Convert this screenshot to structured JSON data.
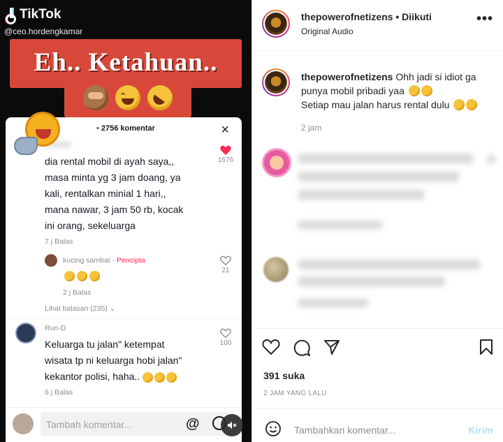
{
  "tiktok": {
    "brand": "TikTok",
    "username": "@ceo.hordengkamar",
    "banner_text": "Eh.. Ketahuan..",
    "comment_count_label": "2756 komentar",
    "close_symbol": "×",
    "comments": [
      {
        "text_lines": [
          "dia rental mobil di ayah saya,,",
          "masa minta yg 3 jam doang, ya",
          "kali, rentalkan minial 1 hari,,",
          "mana nawar, 3 jam 50 rb, kocak",
          "ini orang, sekeluarga"
        ],
        "meta": "7 j   Balas",
        "likes": "1676"
      },
      {
        "author": "kucing sambat",
        "badge": "· Pencipta",
        "meta": "2 j   Balas",
        "likes": "21"
      },
      {
        "author": "Run-D",
        "text_lines": [
          "Keluarga tu jalan\" ketempat",
          "wisata tp ni keluarga hobi jalan\"",
          "kekantor polisi, haha.."
        ],
        "meta": "6 j   Balas",
        "likes": "100"
      }
    ],
    "view_replies": "Lihat balasan (235)",
    "input_placeholder": "Tambah komentar...",
    "at_symbol": "@"
  },
  "instagram": {
    "username": "thepowerofnetizens",
    "follow_status": " • Diikuti",
    "audio": "Original Audio",
    "more_symbol": "•••",
    "caption_user": "thepowerofnetizens",
    "caption_line1": " Ohh jadi si idiot ga punya mobil pribadi yaa",
    "caption_line2": "Setiap mau jalan harus rental dulu",
    "caption_time": "2 jam",
    "likes": "391 suka",
    "post_time": "2 JAM YANG LALU",
    "add_comment_placeholder": "Tambahkan komentar...",
    "send_label": "Kirim"
  },
  "colors": {
    "banner_red": "#d8483a",
    "tiktok_like": "#fe2c55",
    "ig_send": "#b2dffc"
  }
}
